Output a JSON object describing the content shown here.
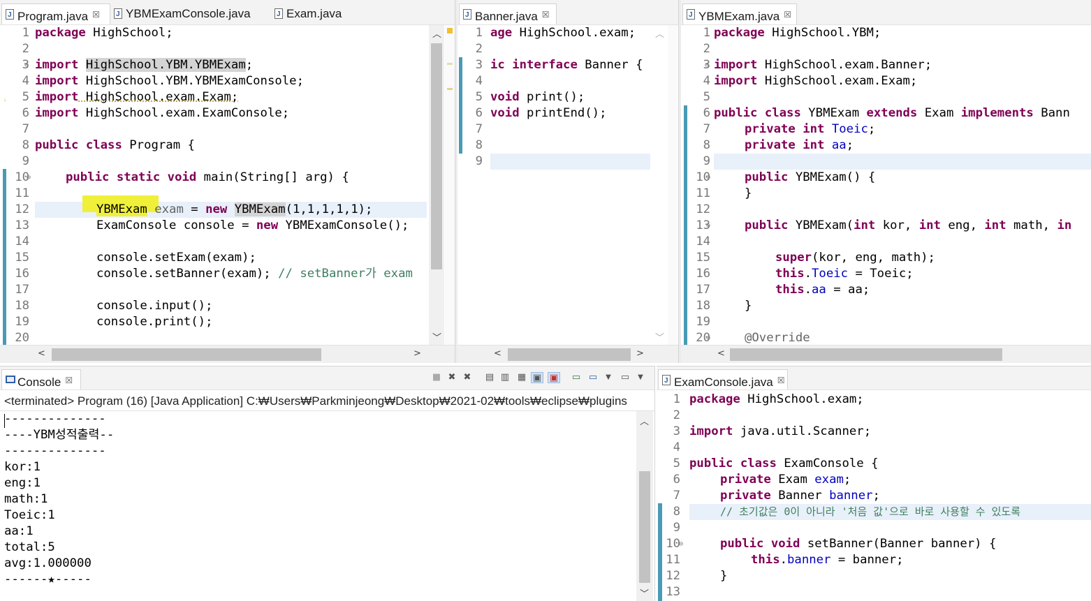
{
  "editors": {
    "program": {
      "tabs": [
        {
          "label": "Program.java",
          "close": "☒",
          "active": true
        },
        {
          "label": "YBMExamConsole.java",
          "active": false
        },
        {
          "label": "Exam.java",
          "active": false
        }
      ],
      "line_numbers": [
        "1",
        "2",
        "3",
        "4",
        "5",
        "6",
        "7",
        "8",
        "9",
        "10",
        "11",
        "12",
        "13",
        "14",
        "15",
        "16",
        "17",
        "18",
        "19",
        "20"
      ],
      "lines": [
        {
          "kw": "package",
          "rest": " HighSchool;"
        },
        {},
        {
          "kw": "import",
          "mark": "HighSchool.YBM.YBMExam",
          "rest": ";"
        },
        {
          "kw": "import",
          "rest": " HighSchool.YBM.YBMExamConsole;"
        },
        {
          "kw": "import",
          "rest": " HighSchool.exam.Exam;"
        },
        {
          "kw": "import",
          "rest": " HighSchool.exam.ExamConsole;"
        },
        {},
        {
          "kw": "public class",
          "rest": " Program {"
        },
        {},
        {
          "kw": "public static void",
          "rest": " main(String[] arg) {"
        },
        {},
        {
          "type": "YBMExam",
          "var": "exam",
          "eq": " = ",
          "kw2": "new",
          "mark2": "YBMExam",
          "rest": "(1,1,1,1,1);"
        },
        {
          "text": "ExamConsole console = ",
          "kw2": "new",
          "rest": " YBMExamConsole();"
        },
        {},
        {
          "text": "console.setExam(exam);"
        },
        {
          "text": "console.setBanner(exam); ",
          "comment": "// setBanner가 exam"
        },
        {},
        {
          "text": "console.input();"
        },
        {
          "text": "console.print();"
        },
        {}
      ]
    },
    "banner": {
      "tabs": [
        {
          "label": "Banner.java",
          "close": "☒",
          "active": true
        }
      ],
      "line_numbers": [
        "1",
        "2",
        "3",
        "4",
        "5",
        "6",
        "7",
        "8",
        "9"
      ],
      "lines": [
        {
          "kw": "age",
          "rest": " HighSchool.exam;"
        },
        {},
        {
          "kw": "ic interface",
          "rest": " Banner {"
        },
        {},
        {
          "kw": "void",
          "rest": " print();"
        },
        {
          "kw": "void",
          "rest": " printEnd();"
        },
        {},
        {},
        {}
      ]
    },
    "ybmexam": {
      "tabs": [
        {
          "label": "YBMExam.java",
          "close": "☒",
          "active": true
        }
      ],
      "line_numbers": [
        "1",
        "2",
        "3",
        "4",
        "5",
        "6",
        "7",
        "8",
        "9",
        "10",
        "11",
        "12",
        "13",
        "14",
        "15",
        "16",
        "17",
        "18",
        "19",
        "20"
      ],
      "lines": [
        {
          "kw": "package",
          "rest": " HighSchool.YBM;"
        },
        {},
        {
          "kw": "import",
          "rest": " HighSchool.exam.Banner;"
        },
        {
          "kw": "import",
          "rest": " HighSchool.exam.Exam;"
        },
        {},
        {
          "kw": "public class",
          "rest": " YBMExam ",
          "kw2": "extends",
          "rest2": " Exam ",
          "kw3": "implements",
          "rest3": " Bann"
        },
        {
          "kw": "private int",
          "field": "Toeic",
          "rest": ";"
        },
        {
          "kw": "private int",
          "field": "aa",
          "rest": ";"
        },
        {},
        {
          "kw": "public",
          "rest": " YBMExam() {"
        },
        {
          "text": "}"
        },
        {},
        {
          "kw": "public",
          "rest": " YBMExam(",
          "kw2": "int",
          "rest2": " kor, ",
          "kw3": "int",
          "rest3": " eng, ",
          "kw4": "int",
          "rest4": " math, ",
          "kw5": "in"
        },
        {},
        {
          "kw": "super",
          "rest": "(kor, eng, math);"
        },
        {
          "kw": "this",
          "dot": ".",
          "field": "Toeic",
          "rest": " = Toeic;"
        },
        {
          "kw": "this",
          "dot": ".",
          "field": "aa",
          "rest": " = aa;"
        },
        {
          "text": "}"
        },
        {},
        {
          "annot": "@Override"
        }
      ]
    },
    "examconsole": {
      "tabs": [
        {
          "label": "ExamConsole.java",
          "close": "☒",
          "active": true
        }
      ],
      "line_numbers": [
        "1",
        "2",
        "3",
        "4",
        "5",
        "6",
        "7",
        "8",
        "9",
        "10",
        "11",
        "12",
        "13"
      ],
      "lines": [
        {
          "kw": "package",
          "rest": " HighSchool.exam;"
        },
        {},
        {
          "kw": "import",
          "rest": " java.util.Scanner;"
        },
        {},
        {
          "kw": "public class",
          "rest": " ExamConsole {"
        },
        {
          "kw": "private",
          "rest": " Exam ",
          "field": "exam",
          "rest2": ";"
        },
        {
          "kw": "private",
          "rest": " Banner ",
          "field": "banner",
          "rest2": ";"
        },
        {
          "comment": "// 초기값은 0이 아니라 '처음 값'으로 바로 사용할 수 있도록"
        },
        {},
        {
          "kw": "public void",
          "rest": " setBanner(Banner banner) {"
        },
        {
          "kw": "this",
          "dot": ".",
          "field": "banner",
          "rest": " = banner;"
        },
        {
          "text": "}"
        },
        {}
      ]
    }
  },
  "console": {
    "tab_label": "Console",
    "tab_close": "☒",
    "status": "<terminated> Program (16) [Java Application] C:₩Users₩Parkminjeong₩Desktop₩2021-02₩tools₩eclipse₩plugins",
    "output": [
      "--------------",
      "----YBM성적출력--",
      "--------------",
      "kor:1",
      "eng:1",
      "math:1",
      "Toeic:1",
      "aa:1",
      "total:5",
      "avg:1.000000",
      "------★-----"
    ],
    "toolbar_icons": [
      "terminate-icon",
      "remove-launch-icon",
      "remove-all-icon",
      "scroll-lock-icon",
      "word-wrap-icon",
      "show-on-output-icon",
      "show-on-error-icon",
      "pin-console-icon",
      "display-console-icon",
      "display-console-dropdown-icon",
      "open-console-icon",
      "open-console-dropdown-icon"
    ]
  },
  "colors": {
    "keyword": "#7f0055",
    "field": "#0000c0",
    "comment": "#3f7f5f",
    "highlight_yellow": "#f0f03a",
    "current_line": "#e8f0fa",
    "ruler_change": "#4a9ab5"
  }
}
